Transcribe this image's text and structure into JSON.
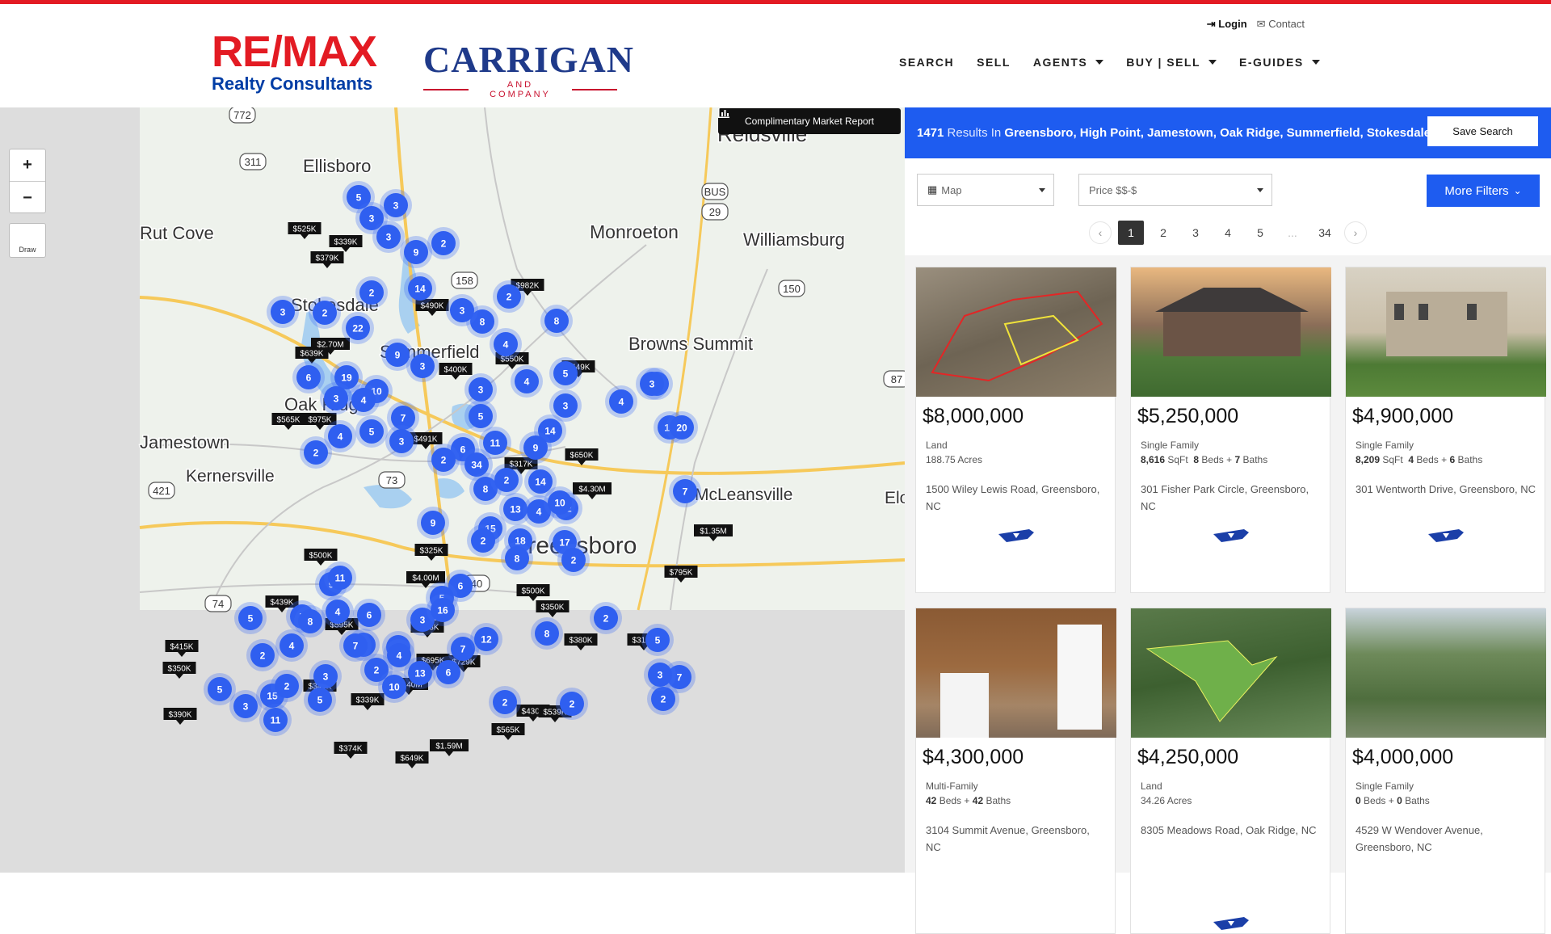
{
  "header": {
    "logo_remax_top": "RE/MAX",
    "logo_remax_sub": "Realty Consultants",
    "logo_carrigan": "CARRIGAN",
    "logo_carrigan_sub": "AND COMPANY",
    "login": "Login",
    "contact": "Contact",
    "nav": [
      "SEARCH",
      "SELL",
      "AGENTS",
      "BUY | SELL",
      "E-GUIDES"
    ]
  },
  "map": {
    "zoom_in": "+",
    "zoom_out": "−",
    "draw": "Draw",
    "market_report": "Complimentary Market Report",
    "place_labels": [
      "Reidsville",
      "Ellisboro",
      "Monroeton",
      "Williamsburg",
      "Stokesdale",
      "Summerfield",
      "Browns Summit",
      "Oak Ridge",
      "Jamestown",
      "Kernersville",
      "McLeansville",
      "Greensboro",
      "Rut Cove",
      "Elon"
    ],
    "road_labels": [
      "772",
      "311",
      "158",
      "29",
      "150",
      "421",
      "73",
      "40",
      "74",
      "BUS",
      "87"
    ],
    "clusters": [
      "5",
      "3",
      "3",
      "3",
      "9",
      "2",
      "14",
      "2",
      "3",
      "2",
      "22",
      "8",
      "3",
      "2",
      "8",
      "4",
      "9",
      "3",
      "6",
      "19",
      "10",
      "3",
      "4",
      "3",
      "4",
      "7",
      "5",
      "3",
      "2",
      "4",
      "5",
      "3",
      "6",
      "14",
      "11",
      "9",
      "2",
      "34",
      "2",
      "5",
      "13",
      "3",
      "20",
      "4",
      "7",
      "9",
      "15",
      "8",
      "2",
      "14",
      "13",
      "4",
      "22",
      "10",
      "18",
      "17",
      "8",
      "2",
      "9",
      "11",
      "6",
      "2",
      "5",
      "7",
      "6",
      "7",
      "8",
      "3",
      "16",
      "12",
      "4",
      "5",
      "2",
      "4",
      "3",
      "5",
      "5",
      "7",
      "4",
      "13",
      "6",
      "2",
      "10",
      "5",
      "15",
      "2",
      "5",
      "8",
      "5",
      "2",
      "2",
      "2",
      "3",
      "11",
      "7",
      "2",
      "3"
    ],
    "price_pins": [
      "$525K",
      "$339K",
      "$379K",
      "$982K",
      "$490K",
      "$639K",
      "$2.70M",
      "$550K",
      "$449K",
      "$400K",
      "$565K",
      "$975K",
      "$491K",
      "$650K",
      "$317K",
      "$4.30M",
      "$1.35M",
      "$500K",
      "$325K",
      "$4.00M",
      "$500K",
      "$795K",
      "$439K",
      "$350K",
      "$595K",
      "$353K",
      "$380K",
      "$310K",
      "$415K",
      "$695K",
      "$729K",
      "$350K",
      "$349K",
      "$2.40M",
      "$339K",
      "$390K",
      "$430K",
      "$539K",
      "$565K",
      "$1.59M",
      "$374K",
      "$649K"
    ]
  },
  "results": {
    "count": "1471",
    "in_label": "Results In",
    "areas": "Greensboro, High Point, Jamestown, Oak Ridge, Summerfield, Stokesdale",
    "save_search": "Save Search"
  },
  "filters": {
    "view": "Map",
    "price_placeholder": "Price $$-$",
    "more_filters": "More Filters"
  },
  "pagination": {
    "prev": "‹",
    "pages": [
      "1",
      "2",
      "3",
      "4",
      "5",
      "...",
      "34"
    ],
    "active": "1",
    "next": "›"
  },
  "listings": [
    {
      "price": "$8,000,000",
      "type": "Land",
      "spec": "188.75 Acres",
      "address": "1500 Wiley Lewis Road, Greensboro, NC"
    },
    {
      "price": "$5,250,000",
      "type": "Single Family",
      "sqft": "8,616",
      "beds": "8",
      "baths": "7",
      "address": "301 Fisher Park Circle, Greensboro, NC"
    },
    {
      "price": "$4,900,000",
      "type": "Single Family",
      "sqft": "8,209",
      "beds": "4",
      "baths": "6",
      "address": "301 Wentworth Drive, Greensboro, NC"
    },
    {
      "price": "$4,300,000",
      "type": "Multi-Family",
      "beds": "42",
      "baths": "42",
      "address": "3104 Summit Avenue, Greensboro, NC"
    },
    {
      "price": "$4,250,000",
      "type": "Land",
      "spec": "34.26 Acres",
      "address": "8305 Meadows Road, Oak Ridge, NC"
    },
    {
      "price": "$4,000,000",
      "type": "Single Family",
      "beds": "0",
      "baths": "0",
      "address": "4529 W Wendover Avenue, Greensboro, NC"
    }
  ],
  "labels": {
    "sqft": "SqFt",
    "beds": "Beds",
    "baths": "Baths",
    "plus": "+"
  },
  "colors": {
    "brand_red": "#e31b23",
    "brand_blue": "#003da5",
    "accent": "#1e5cf0",
    "cluster": "#2f5ff0"
  }
}
